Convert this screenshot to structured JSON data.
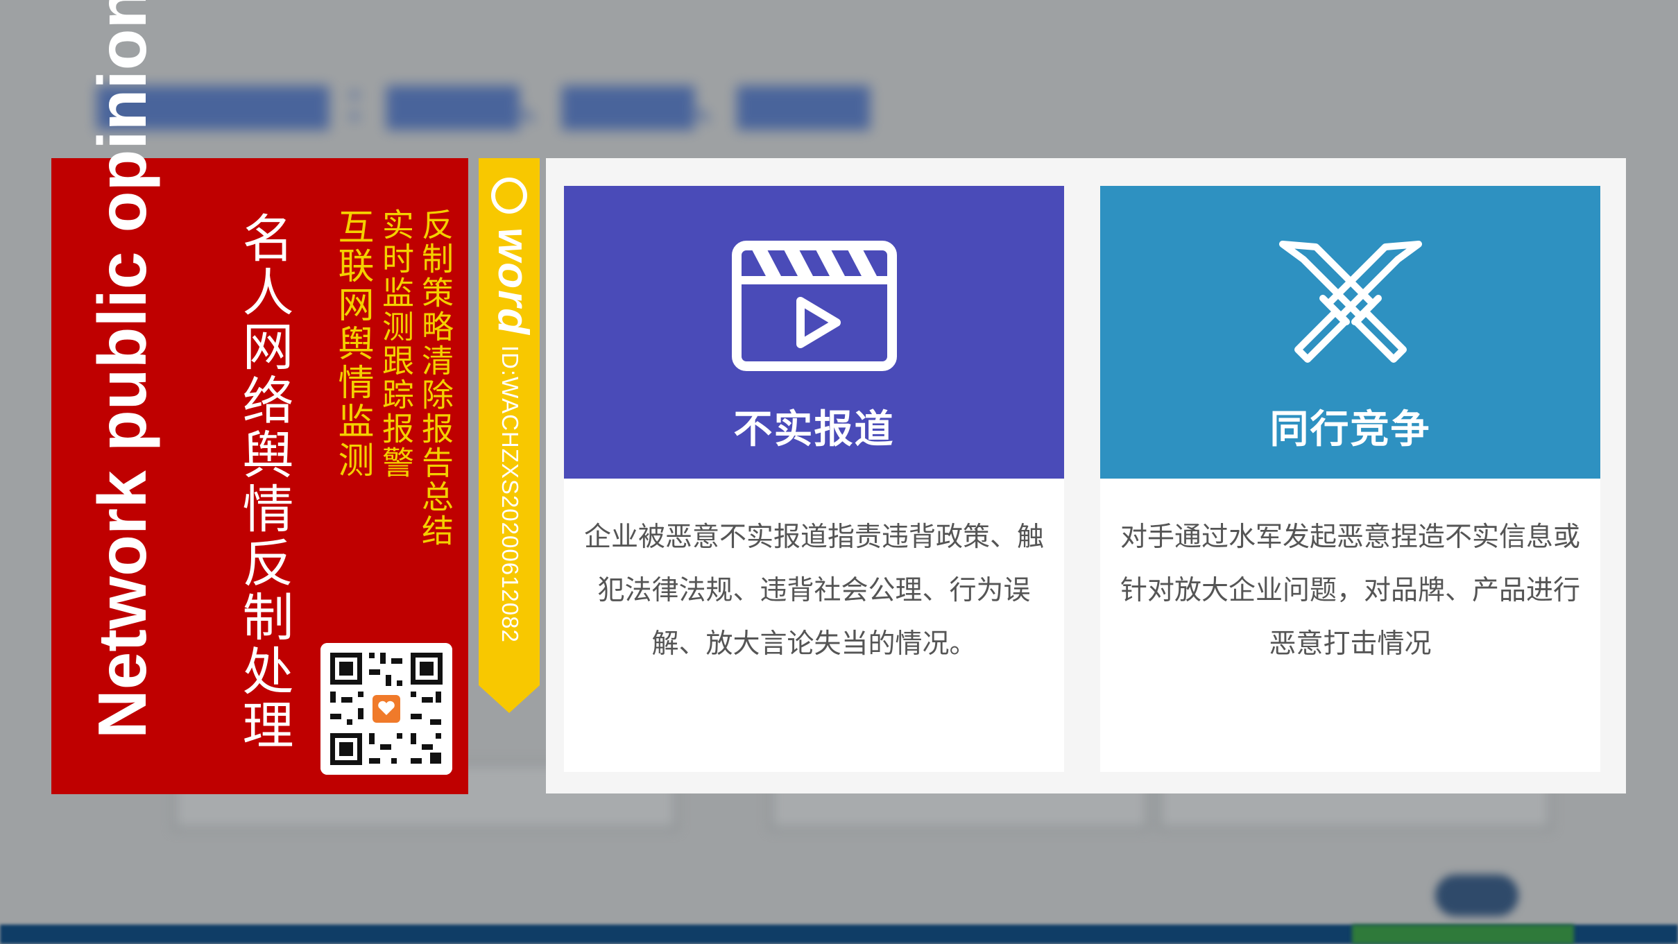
{
  "red_panel": {
    "english_title": "Network public opinion monitoring",
    "chinese_title": "名人网络舆情反制处理",
    "subtitle_1": "互联网舆情监测",
    "subtitle_2": "实时监测跟踪报警",
    "subtitle_3": "反制策略清除报告总结"
  },
  "ribbon": {
    "brand": "word",
    "id_text": "ID:WACHZXS20200612082"
  },
  "cards": [
    {
      "icon": "video-clapperboard-icon",
      "title": "不实报道",
      "description": "企业被恶意不实报道指责违背政策、触犯法律法规、违背社会公理、行为误解、放大言论失当的情况。"
    },
    {
      "icon": "crossed-swords-icon",
      "title": "同行竞争",
      "description": "对手通过水军发起恶意捏造不实信息或针对放大企业问题，对品牌、产品进行恶意打击情况"
    }
  ],
  "colors": {
    "red_panel": "#bf0000",
    "accent_yellow": "#f4d000",
    "card1_header": "#4a4bb8",
    "card2_header": "#2e91c1"
  }
}
